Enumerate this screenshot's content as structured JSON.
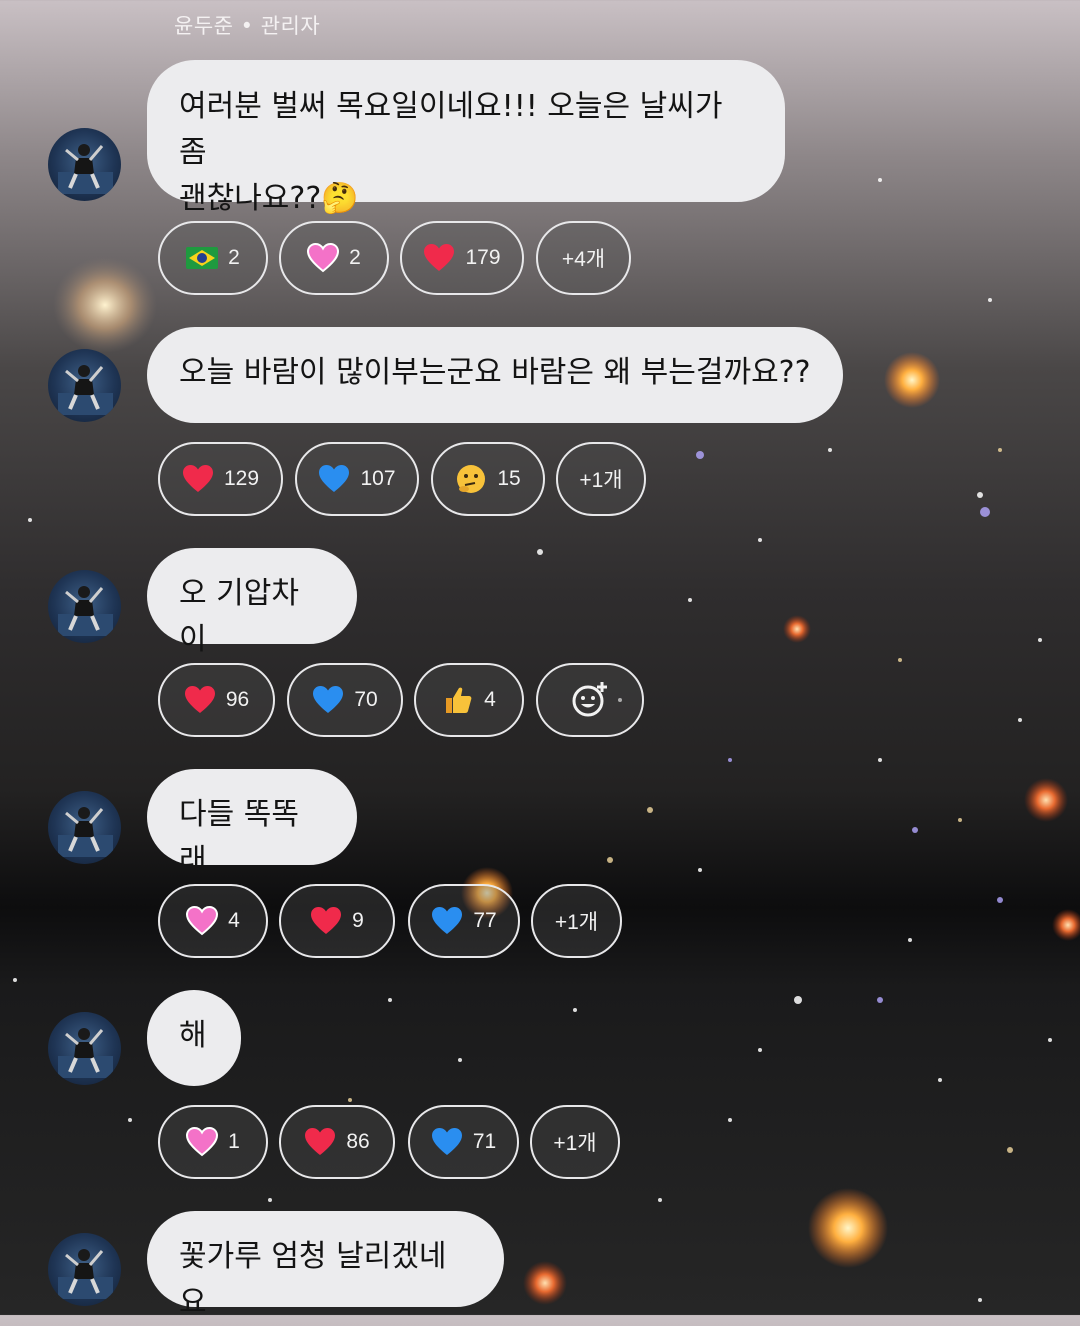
{
  "sender": {
    "name": "윤두준",
    "role": "관리자",
    "separator": " • "
  },
  "messages": [
    {
      "line1": "여러분 벌써 목요일이네요!!! 오늘은 날씨가 좀",
      "line2": "괜찮나요??🤔",
      "reactions": [
        {
          "icon": "brazil-flag-icon",
          "count": "2"
        },
        {
          "icon": "pink-heart-icon",
          "count": "2"
        },
        {
          "icon": "red-heart-icon",
          "count": "179"
        },
        {
          "label": "+4개"
        }
      ]
    },
    {
      "text": "오늘 바람이 많이부는군요 바람은 왜 부는걸까요??",
      "reactions": [
        {
          "icon": "red-heart-icon",
          "count": "129"
        },
        {
          "icon": "blue-heart-icon",
          "count": "107"
        },
        {
          "icon": "thinking-face-icon",
          "count": "15"
        },
        {
          "label": "+1개"
        }
      ]
    },
    {
      "text": "오 기압차이",
      "reactions": [
        {
          "icon": "red-heart-icon",
          "count": "96"
        },
        {
          "icon": "blue-heart-icon",
          "count": "70"
        },
        {
          "icon": "thumbs-up-icon",
          "count": "4"
        },
        {
          "icon": "add-reaction-icon"
        }
      ]
    },
    {
      "text": "다들 똑똑래",
      "reactions": [
        {
          "icon": "pink-heart-icon",
          "count": "4"
        },
        {
          "icon": "red-heart-icon",
          "count": "9"
        },
        {
          "icon": "blue-heart-icon",
          "count": "77"
        },
        {
          "label": "+1개"
        }
      ]
    },
    {
      "text": "해",
      "reactions": [
        {
          "icon": "pink-heart-icon",
          "count": "1"
        },
        {
          "icon": "red-heart-icon",
          "count": "86"
        },
        {
          "icon": "blue-heart-icon",
          "count": "71"
        },
        {
          "label": "+1개"
        }
      ]
    },
    {
      "text": "꽃가루 엄청 날리겠네요"
    }
  ],
  "colors": {
    "bubble": "#ececee",
    "chip_border": "#e8e8ea",
    "red_heart": "#f02a4b",
    "blue_heart": "#2a8ef0",
    "pink_heart": "#f472c8"
  }
}
